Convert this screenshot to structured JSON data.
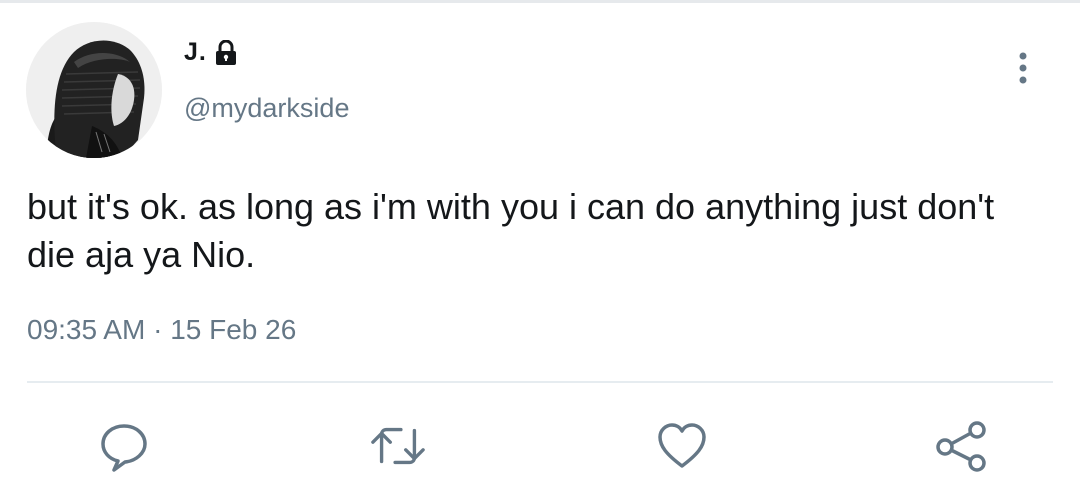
{
  "author": {
    "display_name": "J.",
    "handle": "@mydarkside",
    "avatar": "hooded-person-avatar",
    "locked_icon": "lock-icon"
  },
  "tweet": {
    "text": "but it's ok. as long as i'm with you i can do anything just don't die aja ya Nio.",
    "time": "09:35 AM",
    "separator": "·",
    "date": "15 Feb 26"
  },
  "actions": [
    {
      "icon": "reply-icon"
    },
    {
      "icon": "retweet-icon"
    },
    {
      "icon": "like-icon"
    },
    {
      "icon": "share-icon"
    }
  ],
  "menu_icon": "more-vertical-icon",
  "colors": {
    "text": "#14171a",
    "secondary": "#657786",
    "divider": "#e6ecf0"
  }
}
